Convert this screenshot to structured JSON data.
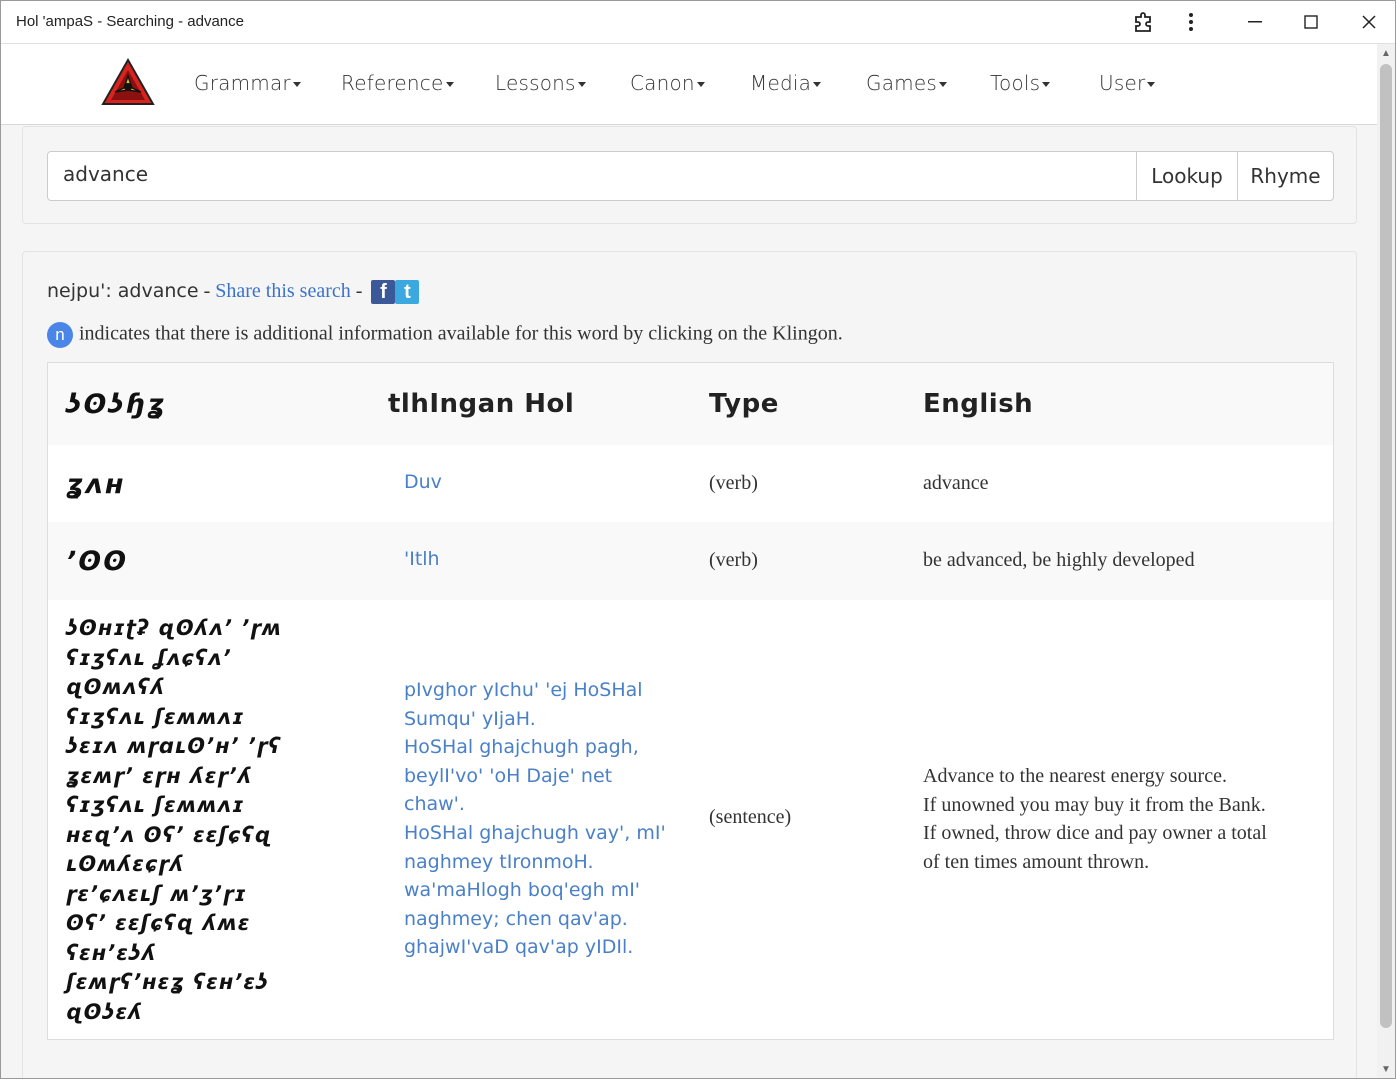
{
  "window": {
    "title": "Hol 'ampaS - Searching - advance",
    "extension_icon": "puzzle-icon",
    "menu_icon": "kebab-icon",
    "minimize": "—",
    "maximize": "☐",
    "close": "✕"
  },
  "nav": {
    "logo": "klingon-trefoil-logo",
    "items": [
      {
        "label": "Grammar"
      },
      {
        "label": "Reference"
      },
      {
        "label": "Lessons"
      },
      {
        "label": "Canon"
      },
      {
        "label": "Media"
      },
      {
        "label": "Games"
      },
      {
        "label": "Tools"
      },
      {
        "label": "User"
      }
    ]
  },
  "search": {
    "value": "advance",
    "lookup_label": "Lookup",
    "rhyme_label": "Rhyme"
  },
  "summary": {
    "prefix": "nejpu': ",
    "query": "advance",
    "sep1": " - ",
    "share_label": "Share this search",
    "sep2": " - ",
    "facebook_icon": "f",
    "twitter_icon": "t"
  },
  "info": {
    "badge": "n",
    "text": "indicates that there is additional information available for this word by clicking on the Klingon."
  },
  "table": {
    "headers": {
      "piqad": "ʖʘʖɧʓ",
      "tlhingan": "tlhIngan Hol",
      "type": "Type",
      "english": "English"
    },
    "rows": [
      {
        "piqad": [
          "ʓʌʜ"
        ],
        "klingon": [
          "Duv"
        ],
        "type": "(verb)",
        "english": [
          "advance"
        ]
      },
      {
        "piqad": [
          "ʼʘʘ"
        ],
        "klingon": [
          "'Itlh"
        ],
        "type": "(verb)",
        "english": [
          "be advanced, be highly developed"
        ]
      },
      {
        "piqad": [
          "ʖʘʜɪʈʡ ɋʘʎʌʼ ʼɼʍ",
          "ʕɪʒʕʌʟ ʆʌɕʕʌʼ",
          "ɋʘʍʌʕʎ",
          "ʕɪʒʕʌʟ ʃɛʍʍʌɪ",
          "ʖɛɪʌ ʍɼɑʟʘʼʜʼ ʼɼʕ",
          "ʓɛʍɼʼ ɛɼʜ ʎɛɼʼʎ",
          "ʕɪʒʕʌʟ ʃɛʍʍʌɪ",
          "ʜɛɋʼʌ ʘʕʼ ɛɛʃɕʕɋ",
          "ʟʘʍʎɛɕɼʎ",
          "ɼɛʼɕʌɛʟʃ ʍʼʒʼɼɪ",
          "ʘʕʼ ɛɛʃɕʕɋ ʎʍɛ",
          "ʕɛʜʼɛʖʎ",
          "ʃɛʍɼʕʼʜɛʓ ʕɛʜʼɛʖ",
          "ɋʘʖɛʎ"
        ],
        "klingon": [
          "pIvghor yIchu' 'ej HoSHal",
          "Sumqu' yIjaH.",
          "HoSHal ghajchugh pagh,",
          "beylI'vo' 'oH Daje' net",
          "chaw'.",
          "HoSHal ghajchugh vay', mI'",
          "naghmey tIronmoH.",
          "wa'maHlogh boq'egh mI'",
          "naghmey; chen qav'ap.",
          "ghajwI'vaD qav'ap yIDIl."
        ],
        "type": "(sentence)",
        "english": [
          "Advance to the nearest energy source.",
          "If unowned you may buy it from the Bank.",
          "If owned, throw dice and pay owner a total",
          "of ten times amount thrown."
        ]
      }
    ]
  },
  "colors": {
    "link": "#3b73c9",
    "badge": "#4a86e8",
    "logo_red": "#d9231f",
    "logo_yellow": "#f2c417"
  }
}
